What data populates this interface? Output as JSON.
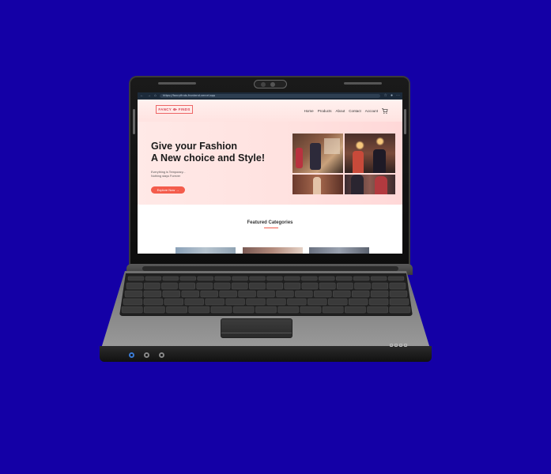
{
  "browser": {
    "url": "https://fancyfinds-frontend.vercel.app"
  },
  "site": {
    "logo_text": "FANCY ⟴ FINDS",
    "nav": [
      "Home",
      "Products",
      "About",
      "Contact",
      "Account"
    ],
    "hero": {
      "title_line1": "Give your Fashion",
      "title_line2": "A New choice and Style!",
      "subtitle_line1": "Everything is Temporary...",
      "subtitle_line2": "Nothing stays Forever",
      "cta_label": "Explore Now →"
    },
    "featured_title": "Featured Categories"
  },
  "colors": {
    "background": "#1400a6",
    "accent": "#f45c4c",
    "hero_bg": "#ffe3e1"
  }
}
